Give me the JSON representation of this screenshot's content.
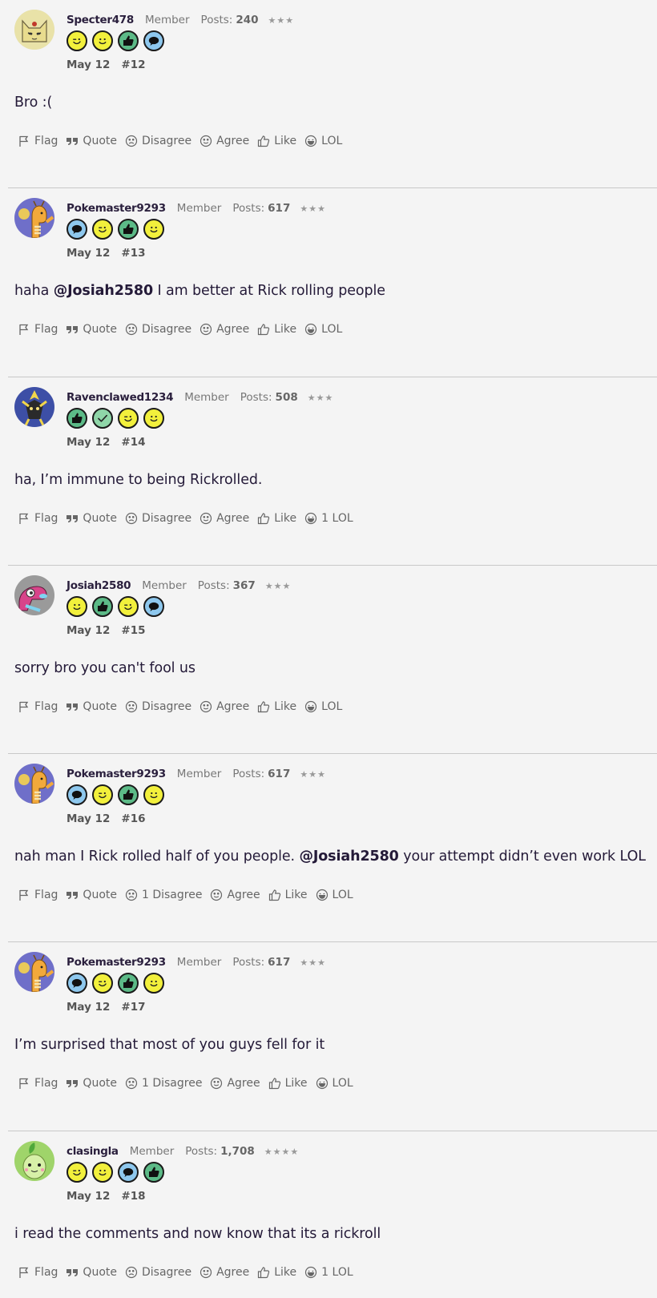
{
  "posts": [
    {
      "username": "Specter478",
      "role": "Member",
      "posts_label": "Posts:",
      "posts_count": "240",
      "stars": "★★★",
      "avatar": "cat-avatar",
      "avatar_bg": "#e9e2a8",
      "badges": [
        "wink",
        "smile",
        "thumbs",
        "speech"
      ],
      "date": "May 12",
      "number": "#12",
      "body": [
        {
          "t": "Bro :("
        }
      ],
      "actions": {
        "flag": "Flag",
        "quote": "Quote",
        "disagree": "Disagree",
        "agree": "Agree",
        "like": "Like",
        "lol": "LOL"
      }
    },
    {
      "username": "Pokemaster9293",
      "role": "Member",
      "posts_label": "Posts:",
      "posts_count": "617",
      "stars": "★★★",
      "avatar": "dragonite-avatar",
      "avatar_bg": "#6f6fc9",
      "badges": [
        "speech",
        "wink",
        "thumbs",
        "smile"
      ],
      "date": "May 12",
      "number": "#13",
      "body": [
        {
          "t": "haha "
        },
        {
          "t": "@Josiah2580",
          "m": true
        },
        {
          "t": " I am better at Rick rolling people"
        }
      ],
      "actions": {
        "flag": "Flag",
        "quote": "Quote",
        "disagree": "Disagree",
        "agree": "Agree",
        "like": "Like",
        "lol": "LOL"
      }
    },
    {
      "username": "Ravenclawed1234",
      "role": "Member",
      "posts_label": "Posts:",
      "posts_count": "508",
      "stars": "★★★",
      "avatar": "pokemon-avatar",
      "avatar_bg": "#3d4fa6",
      "badges": [
        "thumbs",
        "check",
        "wink",
        "smile"
      ],
      "date": "May 12",
      "number": "#14",
      "body": [
        {
          "t": "ha, I’m immune to being Rickrolled."
        }
      ],
      "actions": {
        "flag": "Flag",
        "quote": "Quote",
        "disagree": "Disagree",
        "agree": "Agree",
        "like": "Like",
        "lol": "1 LOL"
      }
    },
    {
      "username": "Josiah2580",
      "role": "Member",
      "posts_label": "Posts:",
      "posts_count": "367",
      "stars": "★★★",
      "avatar": "porygon-avatar",
      "avatar_bg": "#9a9a9a",
      "badges": [
        "smile",
        "thumbs",
        "wink",
        "speech"
      ],
      "date": "May 12",
      "number": "#15",
      "body": [
        {
          "t": "sorry bro you can't fool us"
        }
      ],
      "actions": {
        "flag": "Flag",
        "quote": "Quote",
        "disagree": "Disagree",
        "agree": "Agree",
        "like": "Like",
        "lol": "LOL"
      }
    },
    {
      "username": "Pokemaster9293",
      "role": "Member",
      "posts_label": "Posts:",
      "posts_count": "617",
      "stars": "★★★",
      "avatar": "dragonite-avatar",
      "avatar_bg": "#6f6fc9",
      "badges": [
        "speech",
        "wink",
        "thumbs",
        "smile"
      ],
      "date": "May 12",
      "number": "#16",
      "body": [
        {
          "t": "nah man I Rick rolled half of you people. "
        },
        {
          "t": "@Josiah2580",
          "m": true
        },
        {
          "t": " your attempt didn’t even work LOL"
        }
      ],
      "actions": {
        "flag": "Flag",
        "quote": "Quote",
        "disagree": "1 Disagree",
        "agree": "Agree",
        "like": "Like",
        "lol": "LOL"
      }
    },
    {
      "username": "Pokemaster9293",
      "role": "Member",
      "posts_label": "Posts:",
      "posts_count": "617",
      "stars": "★★★",
      "avatar": "dragonite-avatar",
      "avatar_bg": "#6f6fc9",
      "badges": [
        "speech",
        "wink",
        "thumbs",
        "smile"
      ],
      "date": "May 12",
      "number": "#17",
      "body": [
        {
          "t": "I’m surprised that most of you guys fell for it"
        }
      ],
      "actions": {
        "flag": "Flag",
        "quote": "Quote",
        "disagree": "1 Disagree",
        "agree": "Agree",
        "like": "Like",
        "lol": "LOL"
      }
    },
    {
      "username": "clasingla",
      "role": "Member",
      "posts_label": "Posts:",
      "posts_count": "1,708",
      "stars": "★★★★",
      "avatar": "chikorita-avatar",
      "avatar_bg": "#9fd46a",
      "badges": [
        "wink",
        "smile",
        "speech",
        "thumbs"
      ],
      "date": "May 12",
      "number": "#18",
      "body": [
        {
          "t": "i read the comments and now know that its a rickroll"
        }
      ],
      "actions": {
        "flag": "Flag",
        "quote": "Quote",
        "disagree": "Disagree",
        "agree": "Agree",
        "like": "Like",
        "lol": "1 LOL"
      }
    }
  ],
  "colors": {
    "background": "#f4f4f4",
    "text": "#241a38",
    "muted": "#666666",
    "divider": "#c8c8c8"
  }
}
